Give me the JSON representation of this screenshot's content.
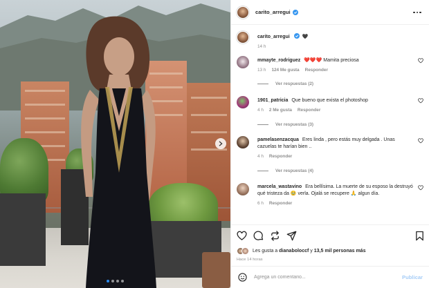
{
  "post": {
    "author": "carito_arregui",
    "verified": true,
    "caption_emoji": "🖤",
    "caption_time": "14 h",
    "carousel": {
      "slides": 4,
      "active_index": 0
    }
  },
  "comments": [
    {
      "user": "mmayte_rodriguez",
      "text": "❤️❤️❤️ Mamita preciosa",
      "time": "13 h",
      "likes": "124 Me gusta",
      "reply_label": "Responder",
      "view_replies": "Ver respuestas (2)"
    },
    {
      "user": "1901_patricia",
      "text": "Que bueno que exista el photoshop",
      "time": "4 h",
      "likes": "2 Me gusta",
      "reply_label": "Responder",
      "view_replies": "Ver respuestas (3)"
    },
    {
      "user": "pamelasenzacqua",
      "text": "Eres linda , pero estás muy delgada . Unas cazuelas te harían bien ..",
      "time": "4 h",
      "likes": "",
      "reply_label": "Responder",
      "view_replies": "Ver respuestas (4)"
    },
    {
      "user": "marcela_wastavino",
      "text": "Era bellísima. La muerte de su esposo la destruyó qué tristeza da 🥹 verla. Ojalá se recupere 🙏 algun día.",
      "time": "6 h",
      "likes": "",
      "reply_label": "Responder",
      "view_replies": ""
    }
  ],
  "actions": {
    "like_icon": "heart-icon",
    "comment_icon": "comment-icon",
    "share_icon": "repost-icon",
    "send_icon": "send-icon",
    "save_icon": "bookmark-icon"
  },
  "likes": {
    "prefix": "Les gusta a",
    "user": "dianaboloccf",
    "joiner": "y",
    "others": "13,5 mil personas más"
  },
  "timestamp": "Hace 14 horas",
  "composer": {
    "emoji_icon": "smiley-icon",
    "placeholder": "Agrega un comentario...",
    "publish_label": "Publicar"
  },
  "colors": {
    "verified_blue": "#3897f0",
    "like_red": "#ed4956",
    "publish_disabled": "#a6cdf7"
  }
}
